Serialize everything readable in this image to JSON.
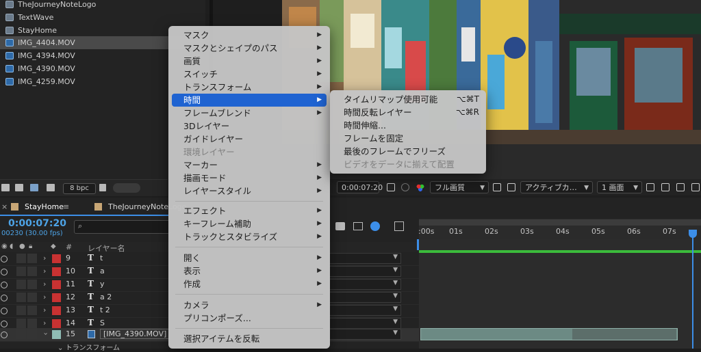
{
  "project": {
    "items": [
      {
        "label": "TheJourneyNoteLogo",
        "icon": "comp-icon"
      },
      {
        "label": "TextWave",
        "icon": "comp-icon"
      },
      {
        "label": "StayHome",
        "icon": "comp-icon"
      },
      {
        "label": "IMG_4404.MOV",
        "icon": "movie-icon"
      },
      {
        "label": "IMG_4394.MOV",
        "icon": "movie-icon"
      },
      {
        "label": "IMG_4390.MOV",
        "icon": "movie-icon"
      },
      {
        "label": "IMG_4259.MOV",
        "icon": "movie-icon"
      }
    ],
    "bpc": "8 bpc"
  },
  "viewer_toolbar": {
    "timecode": "0:00:07:20",
    "quality": "フル画質",
    "camera": "アクティブカ…",
    "views": "1 画面"
  },
  "timeline": {
    "tabs": [
      "StayHome",
      "TheJourneyNoteLogo"
    ],
    "current_time": "0:00:07:20",
    "frame_fps": "00230 (30.00 fps)",
    "col_num": "#",
    "col_name": "レイヤー名",
    "layers": [
      {
        "num": "9",
        "type": "T",
        "name": "t",
        "label_color": "#c83232"
      },
      {
        "num": "10",
        "type": "T",
        "name": "a",
        "label_color": "#c83232"
      },
      {
        "num": "11",
        "type": "T",
        "name": "y",
        "label_color": "#c83232"
      },
      {
        "num": "12",
        "type": "T",
        "name": "a 2",
        "label_color": "#c83232"
      },
      {
        "num": "13",
        "type": "T",
        "name": "t 2",
        "label_color": "#c83232"
      },
      {
        "num": "14",
        "type": "T",
        "name": "S",
        "label_color": "#c83232"
      },
      {
        "num": "15",
        "type": "",
        "name": "[IMG_4390.MOV]",
        "label_color": "#8fbcb4"
      }
    ],
    "transform_label": "トランスフォーム",
    "ruler_ticks": [
      ":00s",
      "01s",
      "02s",
      "03s",
      "04s",
      "05s",
      "06s",
      "07s"
    ]
  },
  "context_menu": {
    "items": [
      {
        "label": "マスク",
        "submenu": true
      },
      {
        "label": "マスクとシェイプのパス",
        "submenu": true
      },
      {
        "label": "画質",
        "submenu": true
      },
      {
        "label": "スイッチ",
        "submenu": true
      },
      {
        "label": "トランスフォーム",
        "submenu": true
      },
      {
        "label": "時間",
        "submenu": true,
        "highlighted": true
      },
      {
        "label": "フレームブレンド",
        "submenu": true
      },
      {
        "label": "3Dレイヤー",
        "submenu": false
      },
      {
        "label": "ガイドレイヤー",
        "submenu": false
      },
      {
        "label": "環境レイヤー",
        "submenu": false,
        "disabled": true
      },
      {
        "label": "マーカー",
        "submenu": true
      },
      {
        "label": "描画モード",
        "submenu": true
      },
      {
        "label": "レイヤースタイル",
        "submenu": true
      },
      {
        "label": "エフェクト",
        "submenu": true
      },
      {
        "label": "キーフレーム補助",
        "submenu": true
      },
      {
        "label": "トラックとスタビライズ",
        "submenu": true
      },
      {
        "label": "開く",
        "submenu": true
      },
      {
        "label": "表示",
        "submenu": true
      },
      {
        "label": "作成",
        "submenu": true
      },
      {
        "label": "カメラ",
        "submenu": true
      },
      {
        "label": "プリコンポーズ...",
        "submenu": false
      },
      {
        "label": "選択アイテムを反転",
        "submenu": false
      }
    ]
  },
  "time_submenu": {
    "items": [
      {
        "label": "タイムリマップ使用可能",
        "shortcut": "⌥⌘T"
      },
      {
        "label": "時間反転レイヤー",
        "shortcut": "⌥⌘R"
      },
      {
        "label": "時間伸縮...",
        "shortcut": ""
      },
      {
        "label": "フレームを固定",
        "shortcut": ""
      },
      {
        "label": "最後のフレームでフリーズ",
        "shortcut": ""
      },
      {
        "label": "ビデオをデータに揃えて配置",
        "shortcut": "",
        "disabled": true
      }
    ]
  },
  "colors": {
    "accent": "#1f63d1",
    "timecode": "#4da3e6",
    "layer_red": "#c83232"
  }
}
